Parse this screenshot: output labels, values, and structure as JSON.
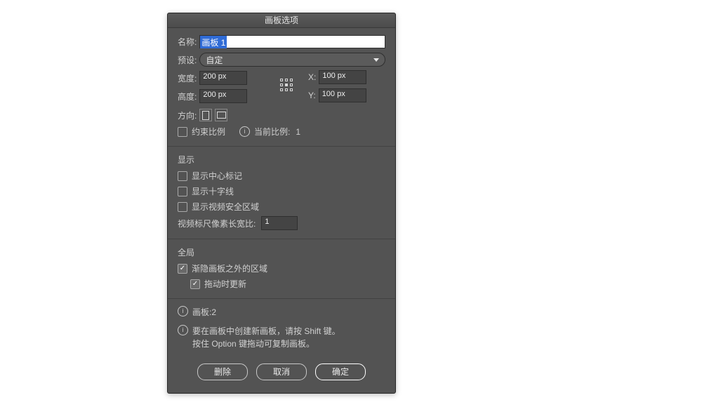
{
  "dialog": {
    "title": "画板选项",
    "name_label": "名称:",
    "name_value": "画板 1",
    "preset_label": "预设:",
    "preset_value": "自定",
    "width_label": "宽度:",
    "width_value": "200 px",
    "height_label": "高度:",
    "height_value": "200 px",
    "x_label": "X:",
    "x_value": "100 px",
    "y_label": "Y:",
    "y_value": "100 px",
    "orient_label": "方向:",
    "constrain_label": "约束比例",
    "current_ratio_label": "当前比例:",
    "current_ratio_value": "1"
  },
  "display": {
    "section_title": "显示",
    "center_mark": "显示中心标记",
    "crosshair": "显示十字线",
    "safe_area": "显示视频安全区域",
    "ruler_label": "视频标尺像素长宽比:",
    "ruler_value": "1"
  },
  "global": {
    "section_title": "全局",
    "fade_outside": "渐隐画板之外的区域",
    "update_drag": "拖动时更新"
  },
  "info": {
    "artboards_label": "画板:",
    "artboards_count": "2",
    "help_line1": "要在画板中创建新画板，请按 Shift 键。",
    "help_line2": "按住 Option 键拖动可复制画板。"
  },
  "buttons": {
    "delete": "删除",
    "cancel": "取消",
    "ok": "确定"
  },
  "checkboxes": {
    "constrain": false,
    "center_mark": false,
    "crosshair": false,
    "safe_area": false,
    "fade_outside": true,
    "update_drag": true
  }
}
